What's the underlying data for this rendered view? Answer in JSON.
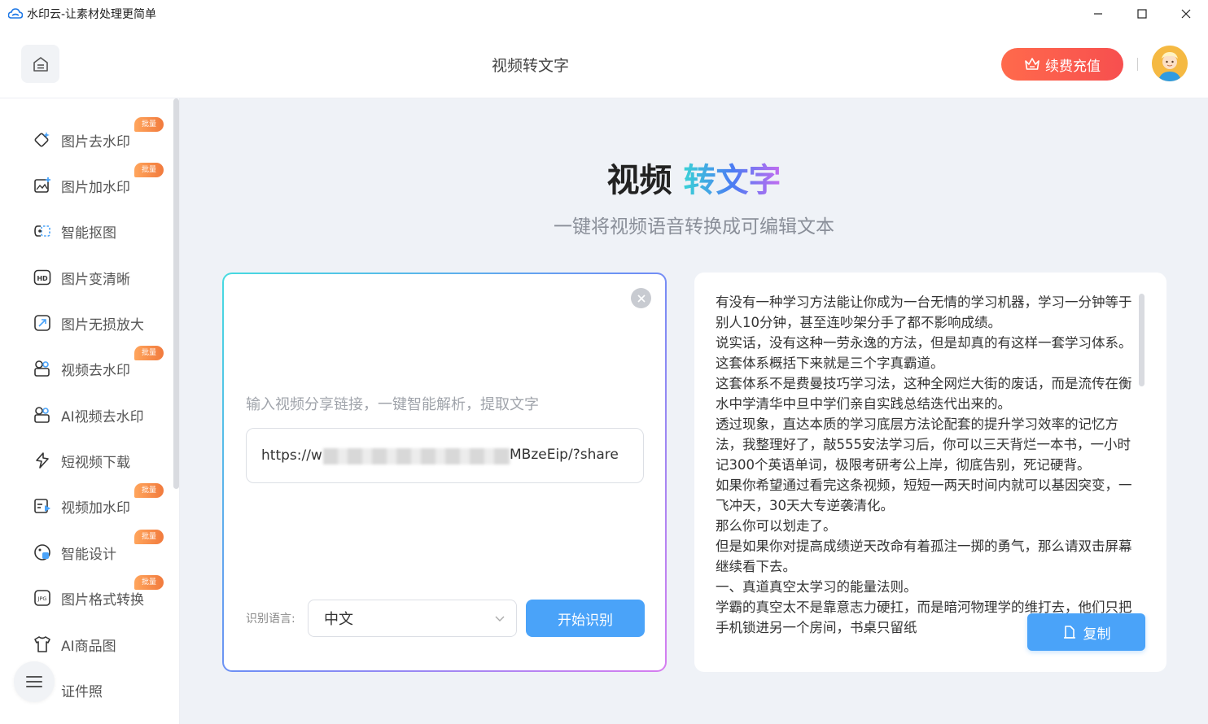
{
  "window": {
    "title": "水印云-让素材处理更简单"
  },
  "header": {
    "page_title": "视频转文字",
    "recharge_label": "续费充值"
  },
  "sidebar": {
    "items": [
      {
        "label": "图片去水印",
        "badge": "批量",
        "icon": "image-eraser-icon"
      },
      {
        "label": "图片加水印",
        "badge": "批量",
        "icon": "image-add-watermark-icon"
      },
      {
        "label": "智能抠图",
        "badge": "",
        "icon": "cutout-icon"
      },
      {
        "label": "图片变清晰",
        "badge": "",
        "icon": "hd-icon"
      },
      {
        "label": "图片无损放大",
        "badge": "",
        "icon": "enlarge-icon"
      },
      {
        "label": "视频去水印",
        "badge": "批量",
        "icon": "video-eraser-icon"
      },
      {
        "label": "AI视频去水印",
        "badge": "",
        "icon": "ai-video-eraser-icon"
      },
      {
        "label": "短视频下载",
        "badge": "",
        "icon": "download-icon"
      },
      {
        "label": "视频加水印",
        "badge": "批量",
        "icon": "video-add-watermark-icon"
      },
      {
        "label": "智能设计",
        "badge": "批量",
        "icon": "design-icon"
      },
      {
        "label": "图片格式转换",
        "badge": "批量",
        "icon": "jpg-format-icon"
      },
      {
        "label": "AI商品图",
        "badge": "",
        "icon": "product-shirt-icon"
      },
      {
        "label": "证件照",
        "badge": "",
        "icon": "id-photo-icon"
      }
    ]
  },
  "hero": {
    "title_dark": "视频",
    "title_gradient": "转文字",
    "subtitle": "一键将视频语音转换成可编辑文本"
  },
  "input_card": {
    "prompt": "输入视频分享链接，一键智能解析，提取文字",
    "url_start": "https://w",
    "url_end": "MBzeEip/?share",
    "language_label": "识别语言:",
    "language_value": "中文",
    "start_label": "开始识别"
  },
  "result": {
    "paragraphs": [
      "有没有一种学习方法能让你成为一台无情的学习机器，学习一分钟等于别人10分钟，甚至连吵架分手了都不影响成绩。",
      "说实话，没有这种一劳永逸的方法，但是却真的有这样一套学习体系。",
      "这套体系概括下来就是三个字真霸道。",
      "这套体系不是费曼技巧学习法，这种全网烂大街的废话，而是流传在衡水中学清华中旦中学们亲自实践总结迭代出来的。",
      "透过现象，直达本质的学习底层方法论配套的提升学习效率的记忆方法，我整理好了，敲555安法学习后，你可以三天背烂一本书，一小时记300个英语单词，极限考研考公上岸，彻底告别，死记硬背。",
      "如果你希望通过看完这条视频，短短一两天时间内就可以基因突变，一飞冲天，30天大专逆袭清化。",
      "那么你可以划走了。",
      "但是如果你对提高成绩逆天改命有着孤注一掷的勇气，那么请双击屏幕继续看下去。",
      "一、真道真空太学习的能量法则。",
      "学霸的真空太不是靠意志力硬扛，而是暗河物理学的维打去，他们只把手机锁进另一个房间，书桌只留纸"
    ],
    "copy_label": "复制"
  }
}
